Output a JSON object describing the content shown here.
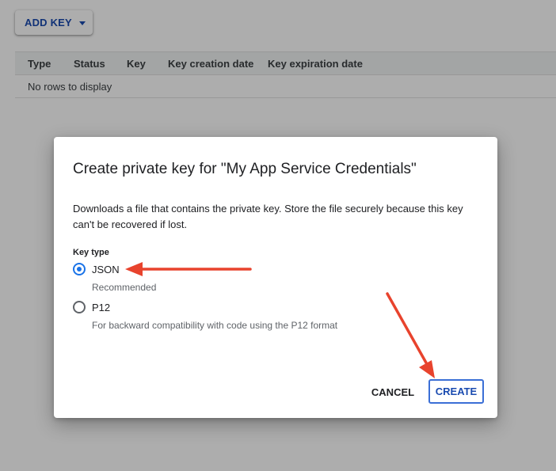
{
  "toolbar": {
    "add_key_label": "ADD KEY"
  },
  "keys_table": {
    "columns": [
      "Type",
      "Status",
      "Key",
      "Key creation date",
      "Key expiration date"
    ],
    "empty_text": "No rows to display"
  },
  "dialog": {
    "title": "Create private key for \"My App Service Credentials\"",
    "description": "Downloads a file that contains the private key. Store the file securely because this key can't be recovered if lost.",
    "key_type_label": "Key type",
    "options": [
      {
        "label": "JSON",
        "hint": "Recommended",
        "selected": true
      },
      {
        "label": "P12",
        "hint": "For backward compatibility with code using the P12 format",
        "selected": false
      }
    ],
    "cancel_label": "CANCEL",
    "create_label": "CREATE"
  },
  "colors": {
    "accent": "#1a73e8",
    "button_text": "#1a4bb0",
    "annotation_arrow": "#e8432d"
  },
  "icons": {
    "dropdown": "caret-down-icon",
    "annotation": "arrow-icon"
  }
}
